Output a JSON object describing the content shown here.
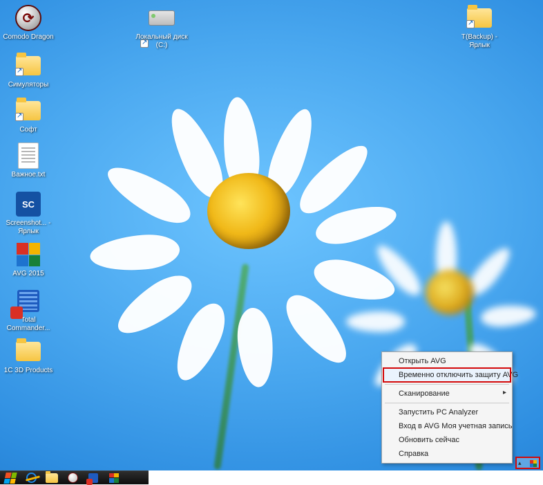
{
  "desktop_icons": {
    "col1": [
      {
        "label": "Comodo Dragon"
      },
      {
        "label": "Симуляторы"
      },
      {
        "label": "Софт"
      },
      {
        "label": "Важное.txt"
      },
      {
        "label": "Screenshot... - Ярлык"
      },
      {
        "label": "AVG 2015"
      },
      {
        "label": "Total Commander..."
      },
      {
        "label": "1C 3D Products"
      }
    ],
    "col2": {
      "label": "Локальный диск (C:)"
    },
    "col3": {
      "label": "T(Backup) - Ярлык"
    }
  },
  "context_menu": {
    "items": [
      {
        "label": "Открыть AVG",
        "type": "item"
      },
      {
        "label": "Временно отключить защиту AVG",
        "type": "highlight"
      },
      {
        "type": "sep"
      },
      {
        "label": "Сканирование",
        "type": "submenu"
      },
      {
        "type": "sep"
      },
      {
        "label": "Запустить PC Analyzer",
        "type": "item"
      },
      {
        "label": "Вход в AVG Моя учетная запись",
        "type": "item"
      },
      {
        "label": "Обновить сейчас",
        "type": "item"
      },
      {
        "label": "Справка",
        "type": "item"
      }
    ]
  },
  "taskbar": {
    "start": "Start",
    "pinned": [
      "Internet Explorer",
      "File Explorer",
      "Comodo Dragon",
      "Total Commander",
      "AVG"
    ]
  }
}
